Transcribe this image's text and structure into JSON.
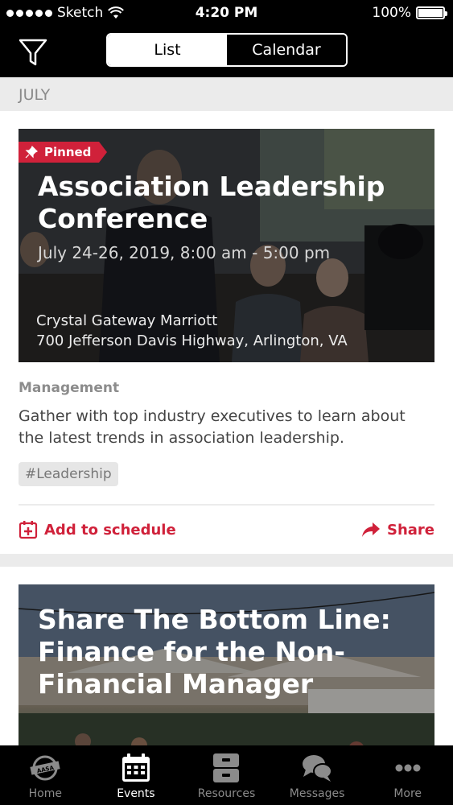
{
  "status_bar": {
    "carrier": "Sketch",
    "time": "4:20 PM",
    "battery": "100%"
  },
  "segmented": {
    "list_label": "List",
    "calendar_label": "Calendar"
  },
  "month": "JULY",
  "events": [
    {
      "pinned_label": "Pinned",
      "title": "Association Leadership Conference",
      "date": "July 24-26, 2019, 8:00 am - 5:00 pm",
      "venue": "Crystal Gateway Marriott",
      "address": "700 Jefferson Davis Highway, Arlington, VA",
      "category": "Management",
      "description": "Gather with top industry executives to learn about the latest trends in association leadership.",
      "tag": "#Leadership",
      "add_label": "Add to schedule",
      "share_label": "Share"
    },
    {
      "title": "Share The Bottom Line: Finance for the Non-Financial Manager"
    }
  ],
  "tabs": [
    {
      "label": "Home",
      "icon": "aasa-logo-icon"
    },
    {
      "label": "Events",
      "icon": "calendar-icon"
    },
    {
      "label": "Resources",
      "icon": "cabinet-icon"
    },
    {
      "label": "Messages",
      "icon": "chat-bubbles-icon"
    },
    {
      "label": "More",
      "icon": "more-dots-icon"
    }
  ],
  "colors": {
    "accent": "#d0213a",
    "bar": "#000000"
  }
}
